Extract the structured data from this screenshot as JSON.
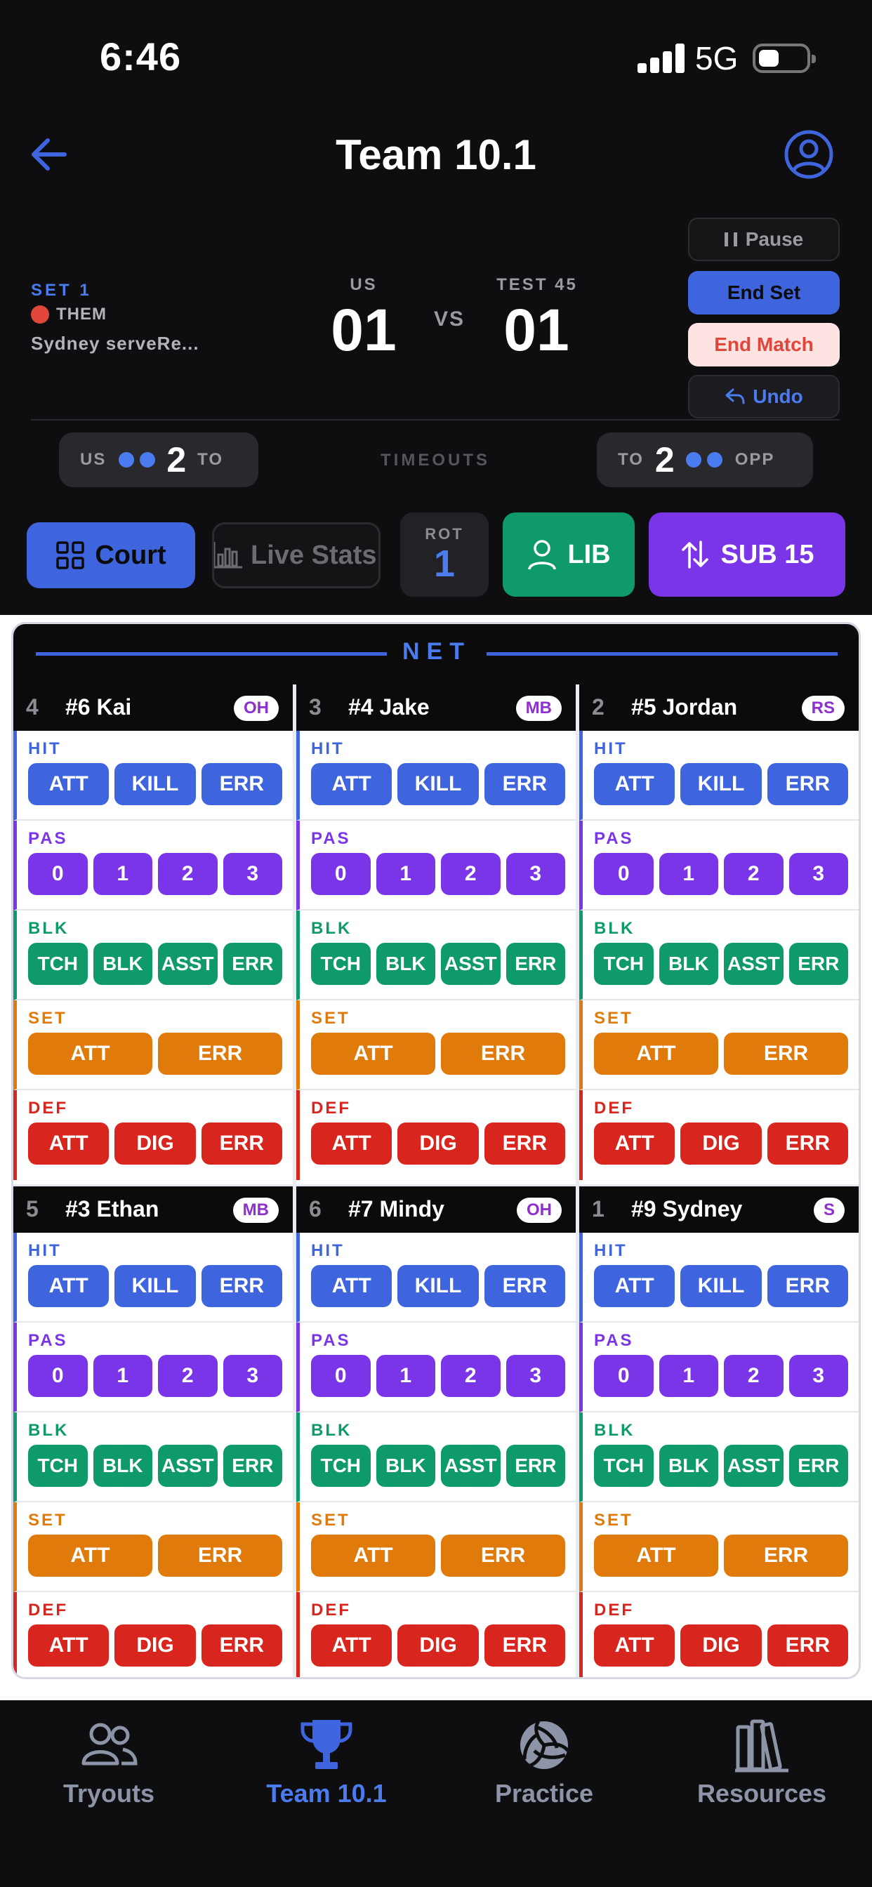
{
  "status": {
    "time": "6:46",
    "network": "5G"
  },
  "header": {
    "title": "Team 10.1"
  },
  "score": {
    "set_label": "SET 1",
    "serving": "THEM",
    "serve_text": "Sydney serveRe...",
    "us_name": "US",
    "us_score": "01",
    "vs": "VS",
    "them_name": "TEST 45",
    "them_score": "01"
  },
  "controls": {
    "pause": "Pause",
    "end_set": "End Set",
    "end_match": "End Match",
    "undo": "Undo"
  },
  "timeouts": {
    "center_label": "TIMEOUTS",
    "us_label": "US",
    "us_to_label": "TO",
    "us_count": "2",
    "opp_to_label": "TO",
    "opp_label": "OPP",
    "opp_count": "2"
  },
  "toolbar": {
    "court": "Court",
    "live_stats": "Live Stats",
    "rot_label": "ROT",
    "rot_value": "1",
    "lib": "LIB",
    "sub": "SUB 15"
  },
  "court": {
    "net_label": "NET"
  },
  "stat_labels": {
    "hit": "HIT",
    "pas": "PAS",
    "blk": "BLK",
    "set": "SET",
    "def": "DEF"
  },
  "stat_buttons": {
    "hit": [
      "ATT",
      "KILL",
      "ERR"
    ],
    "pas": [
      "0",
      "1",
      "2",
      "3"
    ],
    "blk": [
      "TCH",
      "BLK",
      "ASST",
      "ERR"
    ],
    "set": [
      "ATT",
      "ERR"
    ],
    "def": [
      "ATT",
      "DIG",
      "ERR"
    ]
  },
  "players": [
    {
      "pos": "4",
      "name": "#6 Kai",
      "role": "OH"
    },
    {
      "pos": "3",
      "name": "#4 Jake",
      "role": "MB"
    },
    {
      "pos": "2",
      "name": "#5 Jordan",
      "role": "RS"
    },
    {
      "pos": "5",
      "name": "#3 Ethan",
      "role": "MB"
    },
    {
      "pos": "6",
      "name": "#7 Mindy",
      "role": "OH"
    },
    {
      "pos": "1",
      "name": "#9 Sydney",
      "role": "S"
    }
  ],
  "tabs": [
    {
      "label": "Tryouts",
      "icon": "people-icon"
    },
    {
      "label": "Team 10.1",
      "icon": "trophy-icon",
      "active": true
    },
    {
      "label": "Practice",
      "icon": "volleyball-icon"
    },
    {
      "label": "Resources",
      "icon": "library-icon"
    }
  ],
  "colors": {
    "accent_blue": "#3e64de",
    "purple": "#7b35e8",
    "green": "#0e9a6a",
    "orange": "#e07a0b",
    "red": "#d8261f"
  }
}
